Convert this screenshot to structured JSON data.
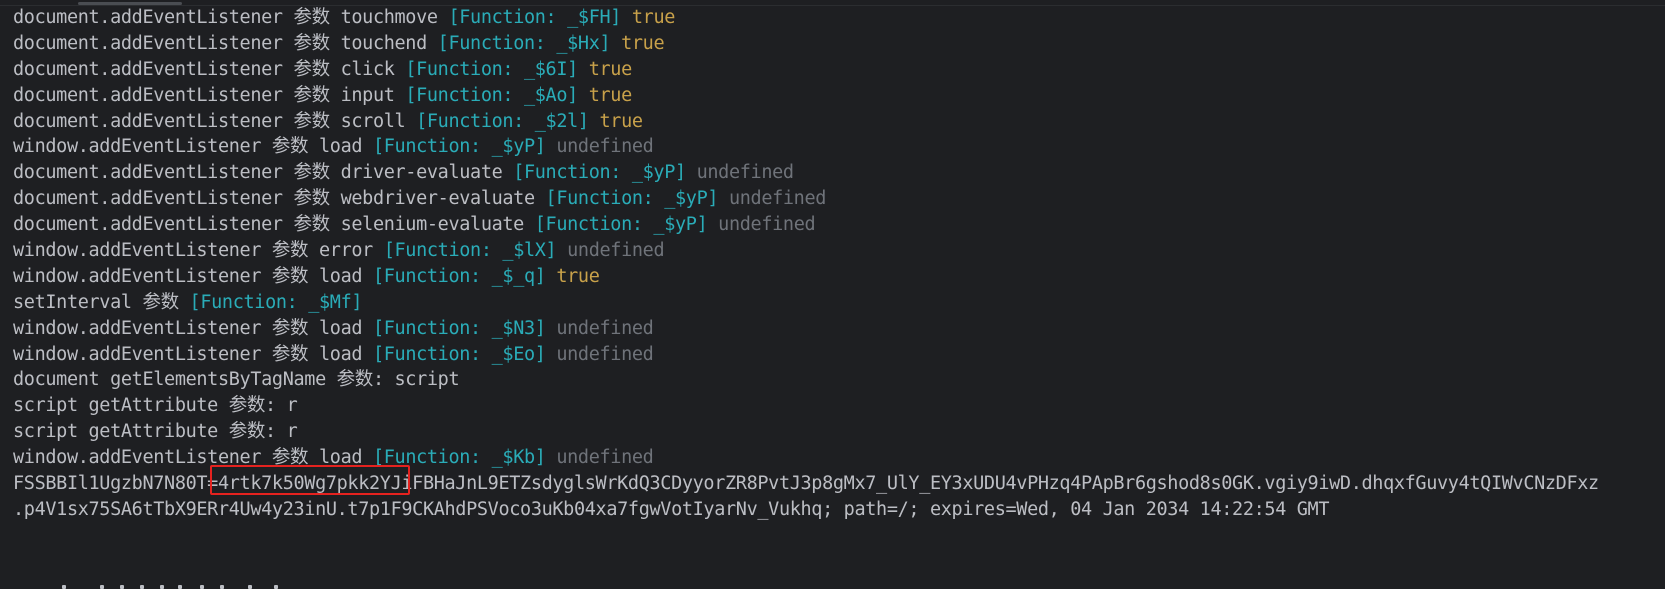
{
  "log_lines": [
    {
      "pre": "document.addEventListener 参数 touchmove ",
      "fn": "[Function: _$FH]",
      "sep": " ",
      "tail": "true",
      "tail_kind": "bool"
    },
    {
      "pre": "document.addEventListener 参数 touchend ",
      "fn": "[Function: _$Hx]",
      "sep": " ",
      "tail": "true",
      "tail_kind": "bool"
    },
    {
      "pre": "document.addEventListener 参数 click ",
      "fn": "[Function: _$6I]",
      "sep": " ",
      "tail": "true",
      "tail_kind": "bool"
    },
    {
      "pre": "document.addEventListener 参数 input ",
      "fn": "[Function: _$Ao]",
      "sep": " ",
      "tail": "true",
      "tail_kind": "bool"
    },
    {
      "pre": "document.addEventListener 参数 scroll ",
      "fn": "[Function: _$2l]",
      "sep": " ",
      "tail": "true",
      "tail_kind": "bool"
    },
    {
      "pre": "window.addEventListener 参数 load ",
      "fn": "[Function: _$yP]",
      "sep": " ",
      "tail": "undefined",
      "tail_kind": "undef"
    },
    {
      "pre": "document.addEventListener 参数 driver-evaluate ",
      "fn": "[Function: _$yP]",
      "sep": " ",
      "tail": "undefined",
      "tail_kind": "undef"
    },
    {
      "pre": "document.addEventListener 参数 webdriver-evaluate ",
      "fn": "[Function: _$yP]",
      "sep": " ",
      "tail": "undefined",
      "tail_kind": "undef"
    },
    {
      "pre": "document.addEventListener 参数 selenium-evaluate ",
      "fn": "[Function: _$yP]",
      "sep": " ",
      "tail": "undefined",
      "tail_kind": "undef"
    },
    {
      "pre": "window.addEventListener 参数 error ",
      "fn": "[Function: _$lX]",
      "sep": " ",
      "tail": "undefined",
      "tail_kind": "undef"
    },
    {
      "pre": "window.addEventListener 参数 load ",
      "fn": "[Function: _$_q]",
      "sep": " ",
      "tail": "true",
      "tail_kind": "bool"
    },
    {
      "pre": "setInterval 参数 ",
      "fn": "[Function: _$Mf]",
      "sep": "",
      "tail": "",
      "tail_kind": "none"
    },
    {
      "pre": "window.addEventListener 参数 load ",
      "fn": "[Function: _$N3]",
      "sep": " ",
      "tail": "undefined",
      "tail_kind": "undef"
    },
    {
      "pre": "window.addEventListener 参数 load ",
      "fn": "[Function: _$Eo]",
      "sep": " ",
      "tail": "undefined",
      "tail_kind": "undef"
    },
    {
      "pre": "document getElementsByTagName 参数: script",
      "fn": "",
      "sep": "",
      "tail": "",
      "tail_kind": "none"
    },
    {
      "pre": "script getAttribute 参数: r",
      "fn": "",
      "sep": "",
      "tail": "",
      "tail_kind": "none"
    },
    {
      "pre": "script getAttribute 参数: r",
      "fn": "",
      "sep": "",
      "tail": "",
      "tail_kind": "none"
    },
    {
      "pre": "window.addEventListener 参数 load ",
      "fn": "[Function: _$Kb]",
      "sep": " ",
      "tail": "undefined",
      "tail_kind": "undef"
    },
    {
      "pre": "FSSBBIl1UgzbN7N80T=4rtk7k50Wg7pkk2YJiFBHaJnL9ETZsdyglsWrKdQ3CDyyorZR8PvtJ3p8gMx7_UlY_EY3xUDU4vPHzq4PApBr6gshod8s0GK.vgiy9iwD.dhqxfGuvy4tQIWvCNzDFxz",
      "fn": "",
      "sep": "",
      "tail": "",
      "tail_kind": "none"
    },
    {
      "pre": ".p4V1sx75SA6tTbX9ERr4Uw4y23inU.t7p1F9CKAhdPSVoco3uKb04xa7fgwVotIyarNv_Vukhq; path=/; expires=Wed, 04 Jan 2034 14:22:54 GMT",
      "fn": "",
      "sep": "",
      "tail": "",
      "tail_kind": "none"
    }
  ],
  "colors": {
    "background": "#1e1f22",
    "text": "#bcbec4",
    "function": "#2aacb8",
    "boolean": "#c8a14a",
    "undefined": "#6f737a",
    "highlight": "#e5221f"
  }
}
